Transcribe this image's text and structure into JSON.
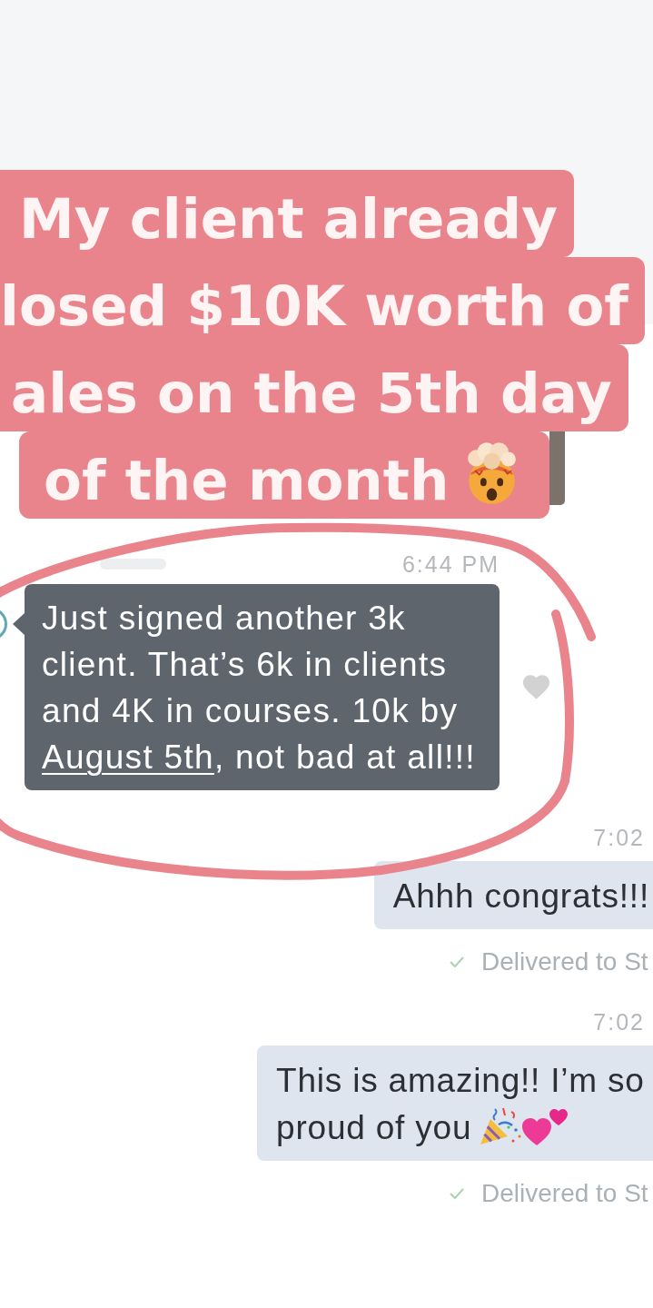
{
  "caption": {
    "lines": [
      {
        "text": "My client already",
        "kind": "plain"
      },
      {
        "text": "losed $10K worth of",
        "kind": "plain"
      },
      {
        "text": "ales on the 5th day",
        "kind": "plain"
      },
      {
        "text": "of the month",
        "kind": "emoji"
      }
    ]
  },
  "messages": [
    {
      "kind": "received",
      "time": "6:44 PM",
      "text": "Just signed another 3k client. That’s 6k in clients and 4K in courses. 10k by",
      "link": "August 5th",
      "text_after": ", not bad at all!!!",
      "liked": false
    },
    {
      "kind": "sent",
      "time": "7:02",
      "text": "Ahhh congrats!!!",
      "status": "Delivered to St"
    },
    {
      "kind": "celebrate",
      "time": "7:02",
      "text": "This is amazing!! I’m so proud of you",
      "status": "Delivered to St"
    }
  ]
}
